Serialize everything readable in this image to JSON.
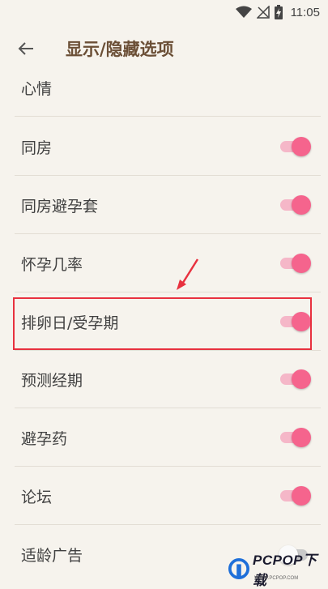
{
  "status_bar": {
    "time": "11:05"
  },
  "header": {
    "title": "显示/隐藏选项",
    "back_icon": "arrow-left-icon"
  },
  "items": [
    {
      "label": "心情",
      "toggle": null
    },
    {
      "label": "同房",
      "toggle": true
    },
    {
      "label": "同房避孕套",
      "toggle": true
    },
    {
      "label": "怀孕几率",
      "toggle": true
    },
    {
      "label": "排卵日/受孕期",
      "toggle": true,
      "highlighted": true
    },
    {
      "label": "预测经期",
      "toggle": true
    },
    {
      "label": "避孕药",
      "toggle": true
    },
    {
      "label": "论坛",
      "toggle": true
    },
    {
      "label": "适龄广告",
      "toggle": false
    }
  ],
  "colors": {
    "accent": "#f5648d",
    "highlight": "#e8313f",
    "title": "#6b4f36"
  },
  "watermark": {
    "brand": "PCPOP下载",
    "sub": "WWW.PCPOP.COM"
  }
}
